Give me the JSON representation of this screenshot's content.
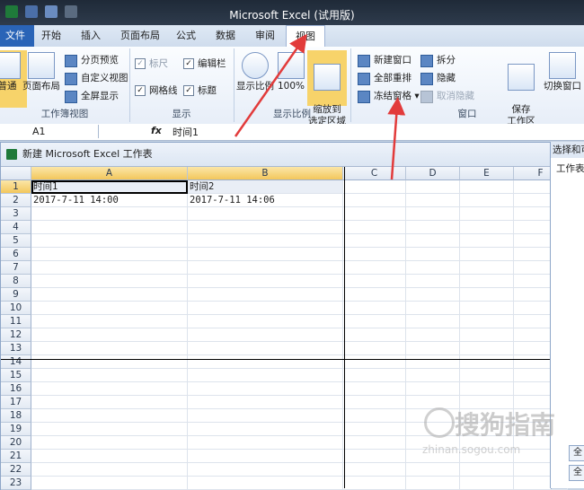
{
  "window": {
    "title": "Microsoft Excel (试用版)"
  },
  "tabs": [
    "文件",
    "开始",
    "插入",
    "页面布局",
    "公式",
    "数据",
    "审阅",
    "视图"
  ],
  "ribbon": {
    "workbook_views": {
      "label": "工作簿视图",
      "normal": "普通",
      "page_layout": "页面布局",
      "page_break": "分页预览",
      "custom_view": "自定义视图",
      "full_screen": "全屏显示"
    },
    "show": {
      "label": "显示",
      "ruler": "标尺",
      "formula_bar": "编辑栏",
      "gridlines": "网格线",
      "headings": "标题"
    },
    "zoom": {
      "label": "显示比例",
      "zoom": "显示比例",
      "hundred": "100%",
      "zoom_sel": "缩放到\n选定区域"
    },
    "window": {
      "label": "窗口",
      "new_window": "新建窗口",
      "arrange_all": "全部重排",
      "freeze_panes": "冻结窗格",
      "split": "拆分",
      "hide": "隐藏",
      "unhide": "取消隐藏",
      "save_ws": "保存\n工作区",
      "switch": "切换窗口"
    }
  },
  "formula_bar": {
    "namebox": "A1",
    "fx": "fx",
    "content": "时间1"
  },
  "workbook": {
    "title": "新建 Microsoft Excel 工作表"
  },
  "sheet": {
    "columns": [
      "A",
      "B",
      "C",
      "D",
      "E",
      "F"
    ],
    "rows": [
      "1",
      "2",
      "3",
      "4",
      "5",
      "6",
      "7",
      "8",
      "9",
      "10",
      "11",
      "12",
      "13",
      "14",
      "15",
      "16",
      "17",
      "18",
      "19",
      "20",
      "21",
      "22",
      "23"
    ],
    "cells": {
      "A1": "时间1",
      "B1": "时间2",
      "A2": "2017-7-11 14:00",
      "B2": "2017-7-11 14:06"
    }
  },
  "side_pane": {
    "title": "选择和可",
    "sub": "工作表中",
    "btn1": "全",
    "btn2": "全"
  },
  "watermark": {
    "main": "搜狗指南",
    "sub": "zhinan.sogou.com"
  },
  "colors": {
    "file_tab": "#2a64b7",
    "selected_header": "#f3c75c",
    "arrow": "#e23b3b"
  }
}
